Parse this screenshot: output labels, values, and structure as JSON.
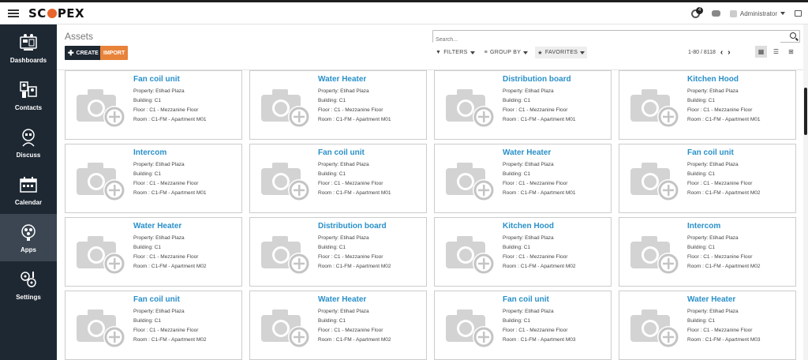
{
  "app": {
    "logo_text_left": "SC",
    "logo_text_right": "PEX",
    "brand_color": "#e8652b"
  },
  "navbar": {
    "notification_count": "4",
    "user_name": "Administrator"
  },
  "sidebar": {
    "items": [
      {
        "label": "Dashboards",
        "icon": "dashboard-icon"
      },
      {
        "label": "Contacts",
        "icon": "contacts-icon"
      },
      {
        "label": "Discuss",
        "icon": "discuss-icon"
      },
      {
        "label": "Calendar",
        "icon": "calendar-icon"
      },
      {
        "label": "Apps",
        "icon": "apps-icon",
        "active": true
      },
      {
        "label": "Settings",
        "icon": "settings-icon"
      }
    ]
  },
  "control_panel": {
    "breadcrumb": "Assets",
    "create_label": "CREATE",
    "import_label": "IMPORT",
    "search_placeholder": "Search...",
    "filters_label": "FILTERS",
    "group_by_label": "GROUP BY",
    "favorites_label": "FAVORITES",
    "pager_value": "1-80 / 8118"
  },
  "cards": [
    {
      "title": "Fan coil unit",
      "property": "Property: Etihad Plaza",
      "building": "Building: C1",
      "floor": "Floor : C1 - Mezzanine Floor",
      "room": "Room : C1-FM - Apartment M01"
    },
    {
      "title": "Water Heater",
      "property": "Property: Etihad Plaza",
      "building": "Building: C1",
      "floor": "Floor : C1 - Mezzanine Floor",
      "room": "Room : C1-FM - Apartment M01"
    },
    {
      "title": "Distribution board",
      "property": "Property: Etihad Plaza",
      "building": "Building: C1",
      "floor": "Floor : C1 - Mezzanine Floor",
      "room": "Room : C1-FM - Apartment M01"
    },
    {
      "title": "Kitchen Hood",
      "property": "Property: Etihad Plaza",
      "building": "Building: C1",
      "floor": "Floor : C1 - Mezzanine Floor",
      "room": "Room : C1-FM - Apartment M01"
    },
    {
      "title": "Intercom",
      "property": "Property: Etihad Plaza",
      "building": "Building: C1",
      "floor": "Floor : C1 - Mezzanine Floor",
      "room": "Room : C1-FM - Apartment M01"
    },
    {
      "title": "Fan coil unit",
      "property": "Property: Etihad Plaza",
      "building": "Building: C1",
      "floor": "Floor : C1 - Mezzanine Floor",
      "room": "Room : C1-FM - Apartment M01"
    },
    {
      "title": "Water Heater",
      "property": "Property: Etihad Plaza",
      "building": "Building: C1",
      "floor": "Floor : C1 - Mezzanine Floor",
      "room": "Room : C1-FM - Apartment M01"
    },
    {
      "title": "Fan coil unit",
      "property": "Property: Etihad Plaza",
      "building": "Building: C1",
      "floor": "Floor : C1 - Mezzanine Floor",
      "room": "Room : C1-FM - Apartment M02"
    },
    {
      "title": "Water Heater",
      "property": "Property: Etihad Plaza",
      "building": "Building: C1",
      "floor": "Floor : C1 - Mezzanine Floor",
      "room": "Room : C1-FM - Apartment M02"
    },
    {
      "title": "Distribution board",
      "property": "Property: Etihad Plaza",
      "building": "Building: C1",
      "floor": "Floor : C1 - Mezzanine Floor",
      "room": "Room : C1-FM - Apartment M02"
    },
    {
      "title": "Kitchen Hood",
      "property": "Property: Etihad Plaza",
      "building": "Building: C1",
      "floor": "Floor : C1 - Mezzanine Floor",
      "room": "Room : C1-FM - Apartment M02"
    },
    {
      "title": "Intercom",
      "property": "Property: Etihad Plaza",
      "building": "Building: C1",
      "floor": "Floor : C1 - Mezzanine Floor",
      "room": "Room : C1-FM - Apartment M02"
    },
    {
      "title": "Fan coil unit",
      "property": "Property: Etihad Plaza",
      "building": "Building: C1",
      "floor": "Floor : C1 - Mezzanine Floor",
      "room": "Room : C1-FM - Apartment M02"
    },
    {
      "title": "Water Heater",
      "property": "Property: Etihad Plaza",
      "building": "Building: C1",
      "floor": "Floor : C1 - Mezzanine Floor",
      "room": "Room : C1-FM - Apartment M02"
    },
    {
      "title": "Fan coil unit",
      "property": "Property: Etihad Plaza",
      "building": "Building: C1",
      "floor": "Floor : C1 - Mezzanine Floor",
      "room": "Room : C1-FM - Apartment M03"
    },
    {
      "title": "Water Heater",
      "property": "Property: Etihad Plaza",
      "building": "Building: C1",
      "floor": "Floor : C1 - Mezzanine Floor",
      "room": "Room : C1-FM - Apartment M03"
    }
  ]
}
